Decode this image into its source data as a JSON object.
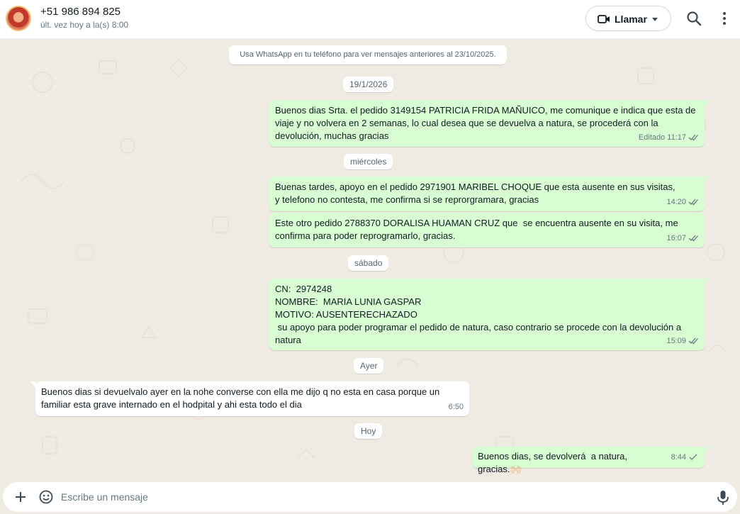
{
  "header": {
    "contact_name": "+51 986 894 825",
    "last_seen": "últ. vez hoy a la(s) 8:00",
    "call_label": "Llamar"
  },
  "chat": {
    "history_notice": "Usa WhatsApp en tu teléfono para ver mensajes anteriores al 23/10/2025.",
    "dates": {
      "d1": "19/1/2026",
      "d2": "miércoles",
      "d3": "sábado",
      "d4": "Ayer",
      "d5": "Hoy"
    },
    "messages": [
      {
        "direction": "out",
        "text": "Buenos dias Srta. el pedido 3149154 PATRICIA FRIDA MAÑUICO, me comunique e indica que esta de viaje y no volvera en 2 semanas, lo cual desea que se devuelva a natura, se procederá con la devolución, muchas gracias",
        "time": "Editado 11:17",
        "status": "read"
      },
      {
        "direction": "out",
        "text": "Buenas tardes, apoyo en el pedido 2971901 MARIBEL CHOQUE que esta ausente en sus visitas, y telefono no contesta, me confirma si se reprorgramara, gracias",
        "time": "14:20",
        "status": "read"
      },
      {
        "direction": "out",
        "text": "Este otro pedido 2788370 DORALISA HUAMAN CRUZ que  se encuentra ausente en su visita, me confirma para poder reprogramarlo, gracias.",
        "time": "16:07",
        "status": "read"
      },
      {
        "direction": "out",
        "text": "CN:  2974248\nNOMBRE:  MARIA LUNIA GASPAR\nMOTIVO: AUSENTERECHAZADO\n su apoyo para poder programar el pedido de natura, caso contrario se procede con la devolución a natura",
        "time": "15:09",
        "status": "read"
      },
      {
        "direction": "in",
        "text": "Buenos dias si devuelvalo ayer en la nohe converse con ella me dijo q no esta en casa porque un familiar esta grave internado en el hodpital y ahi esta todo el dia",
        "time": "6:50"
      },
      {
        "direction": "out",
        "text": "Buenos dias, se devolverá  a natura, gracias.🙌🏻",
        "time": "8:44",
        "status": "sent"
      }
    ]
  },
  "composer": {
    "placeholder": "Escribe un mensaje"
  },
  "colors": {
    "outgoing_bubble": "#d9fdd3",
    "incoming_bubble": "#ffffff",
    "chat_background": "#efeae2",
    "read_tick": "#53bdeb"
  },
  "icons": [
    "video-camera-icon",
    "search-icon",
    "kebab-menu-icon",
    "plus-icon",
    "emoji-icon",
    "microphone-icon",
    "double-check-icon",
    "single-check-icon"
  ]
}
